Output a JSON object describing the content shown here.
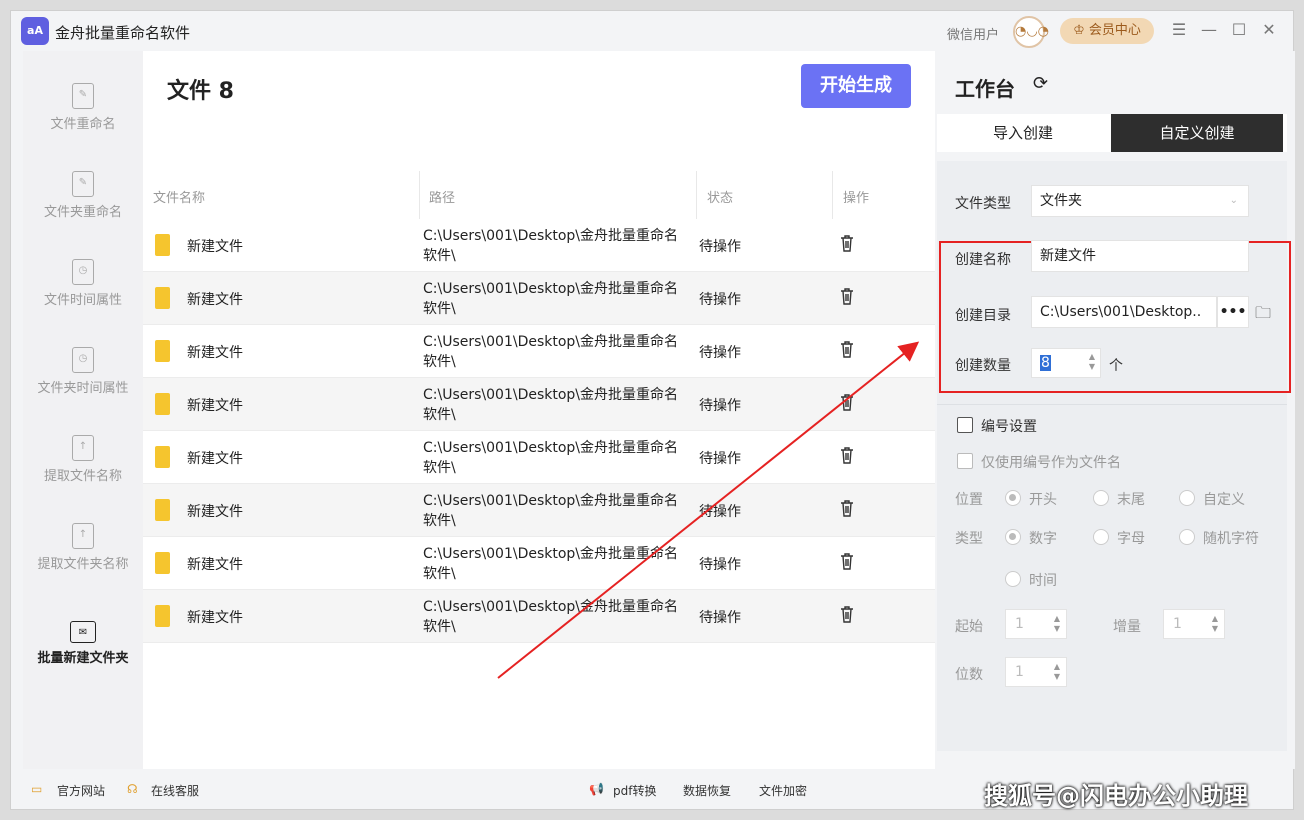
{
  "app": {
    "title": "金舟批量重命名软件",
    "logo_text": "aA",
    "user": "微信用户",
    "vip": "会员中心"
  },
  "sidebar": {
    "items": [
      {
        "label": "文件重命名"
      },
      {
        "label": "文件夹重命名"
      },
      {
        "label": "文件时间属性"
      },
      {
        "label": "文件夹时间属性"
      },
      {
        "label": "提取文件名称"
      },
      {
        "label": "提取文件夹名称"
      },
      {
        "label": "批量新建文件夹"
      }
    ]
  },
  "main": {
    "title": "文件 8",
    "generate_button": "开始生成",
    "columns": [
      "文件名称",
      "路径",
      "状态",
      "操作"
    ],
    "rows": [
      {
        "name": "新建文件",
        "path": "C:\\Users\\001\\Desktop\\金舟批量重命名软件\\",
        "status": "待操作"
      },
      {
        "name": "新建文件",
        "path": "C:\\Users\\001\\Desktop\\金舟批量重命名软件\\",
        "status": "待操作"
      },
      {
        "name": "新建文件",
        "path": "C:\\Users\\001\\Desktop\\金舟批量重命名软件\\",
        "status": "待操作"
      },
      {
        "name": "新建文件",
        "path": "C:\\Users\\001\\Desktop\\金舟批量重命名软件\\",
        "status": "待操作"
      },
      {
        "name": "新建文件",
        "path": "C:\\Users\\001\\Desktop\\金舟批量重命名软件\\",
        "status": "待操作"
      },
      {
        "name": "新建文件",
        "path": "C:\\Users\\001\\Desktop\\金舟批量重命名软件\\",
        "status": "待操作"
      },
      {
        "name": "新建文件",
        "path": "C:\\Users\\001\\Desktop\\金舟批量重命名软件\\",
        "status": "待操作"
      },
      {
        "name": "新建文件",
        "path": "C:\\Users\\001\\Desktop\\金舟批量重命名软件\\",
        "status": "待操作"
      }
    ]
  },
  "workbench": {
    "title": "工作台",
    "tabs": [
      "导入创建",
      "自定义创建"
    ],
    "file_type_label": "文件类型",
    "file_type_value": "文件夹",
    "create_name_label": "创建名称",
    "create_name_value": "新建文件",
    "create_dir_label": "创建目录",
    "create_dir_value": "C:\\Users\\001\\Desktop..",
    "create_count_label": "创建数量",
    "create_count_value": "8",
    "count_unit": "个",
    "numbering_label": "编号设置",
    "only_number_label": "仅使用编号作为文件名",
    "position_label": "位置",
    "position_options": [
      "开头",
      "末尾",
      "自定义"
    ],
    "type_label": "类型",
    "type_options": [
      "数字",
      "字母",
      "随机字符",
      "时间"
    ],
    "start_label": "起始",
    "start_value": "1",
    "increment_label": "增量",
    "increment_value": "1",
    "digits_label": "位数",
    "digits_value": "1"
  },
  "footer": {
    "website": "官方网站",
    "service": "在线客服",
    "pdf": "pdf转换",
    "recovery": "数据恢复",
    "encrypt": "文件加密"
  },
  "watermark": "搜狐号@闪电办公小助理",
  "colors": {
    "accent": "#6b72f4",
    "highlight": "#e52222",
    "folder": "#f5c52e",
    "tab_active": "#2e2e2e"
  }
}
